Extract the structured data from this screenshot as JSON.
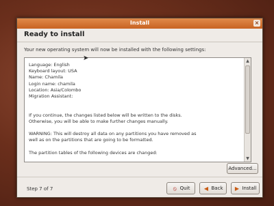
{
  "window": {
    "title": "Install",
    "heading": "Ready to install",
    "subtitle": "Your new operating system will now be installed with the following settings:"
  },
  "summary": {
    "text": "Language: English\nKeyboard layout: USA\nName: Chamila\nLogin name: chamila\nLocation: Asia/Colombo\nMigration Assistant:\n\n\nIf you continue, the changes listed below will be written to the disks.\nOtherwise, you will be able to make further changes manually.\n\nWARNING: This will destroy all data on any partitions you have removed as\nwell as on the partitions that are going to be formatted.\n\nThe partition tables of the following devices are changed:"
  },
  "buttons": {
    "advanced": "Advanced...",
    "quit": "Quit",
    "back": "Back",
    "install": "Install"
  },
  "status": {
    "step": "Step 7 of 7"
  },
  "icons": {
    "close": "close-icon",
    "quit": "quit-icon",
    "back": "back-arrow-icon",
    "install": "forward-arrow-icon"
  }
}
